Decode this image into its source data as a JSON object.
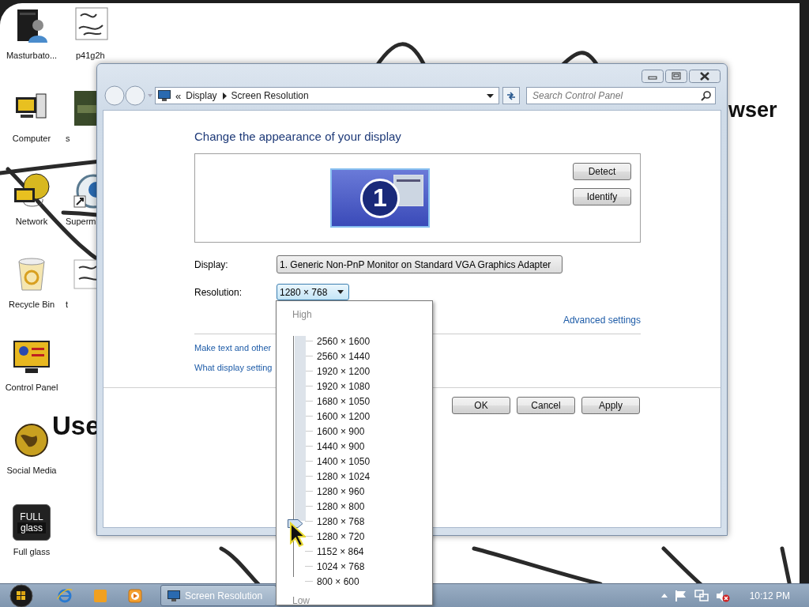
{
  "desktop": {
    "wallpaper_texts": [
      "Use",
      "wser"
    ],
    "icons": [
      {
        "label": "Masturbato...",
        "kind": "user"
      },
      {
        "label": "Computer",
        "kind": "computer"
      },
      {
        "label": "Network",
        "kind": "network"
      },
      {
        "label": "Recycle Bin",
        "kind": "recycle"
      },
      {
        "label": "Control Panel",
        "kind": "control-panel"
      },
      {
        "label": "Social Media",
        "kind": "globe"
      },
      {
        "label": "Full glass",
        "kind": "glass",
        "icon_text": [
          "FULL",
          "glass"
        ]
      },
      {
        "label": "p41g2h",
        "kind": "sketch"
      },
      {
        "label": "s",
        "kind": "photo"
      },
      {
        "label": "Superm",
        "kind": "browser"
      },
      {
        "label": "t",
        "kind": "doc"
      }
    ]
  },
  "window": {
    "address_chevron": "«",
    "breadcrumb": [
      "Display",
      "Screen Resolution"
    ],
    "search": {
      "placeholder": "Search Control Panel"
    },
    "heading": "Change the appearance of your display",
    "monitor_number": "1",
    "side_buttons": [
      "Detect",
      "Identify"
    ],
    "display": {
      "label": "Display:",
      "value": "1. Generic Non-PnP Monitor on Standard VGA Graphics Adapter"
    },
    "resolution": {
      "label": "Resolution:",
      "value": "1280 × 768",
      "expanded": true
    },
    "advanced_link": "Advanced settings",
    "links": [
      "Make text and other",
      "What display setting"
    ],
    "buttons": [
      "OK",
      "Cancel",
      "Apply"
    ]
  },
  "resolution_list": {
    "high": "High",
    "low": "Low",
    "options": [
      {
        "label": "2560 × 1600",
        "selected": false
      },
      {
        "label": "2560 × 1440",
        "selected": false
      },
      {
        "label": "1920 × 1200",
        "selected": false
      },
      {
        "label": "1920 × 1080",
        "selected": false
      },
      {
        "label": "1680 × 1050",
        "selected": false
      },
      {
        "label": "1600 × 1200",
        "selected": false
      },
      {
        "label": "1600 × 900",
        "selected": false
      },
      {
        "label": "1440 × 900",
        "selected": false
      },
      {
        "label": "1400 × 1050",
        "selected": false
      },
      {
        "label": "1280 × 1024",
        "selected": false
      },
      {
        "label": "1280 × 960",
        "selected": false
      },
      {
        "label": "1280 × 800",
        "selected": false
      },
      {
        "label": "1280 × 768",
        "selected": true
      },
      {
        "label": "1280 × 720",
        "selected": false
      },
      {
        "label": "1152 × 864",
        "selected": false
      },
      {
        "label": "1024 × 768",
        "selected": false
      },
      {
        "label": "800 × 600",
        "selected": false
      }
    ]
  },
  "taskbar": {
    "tasks": [
      {
        "label": "Screen Resolution"
      }
    ],
    "clock": "10:12 PM"
  }
}
